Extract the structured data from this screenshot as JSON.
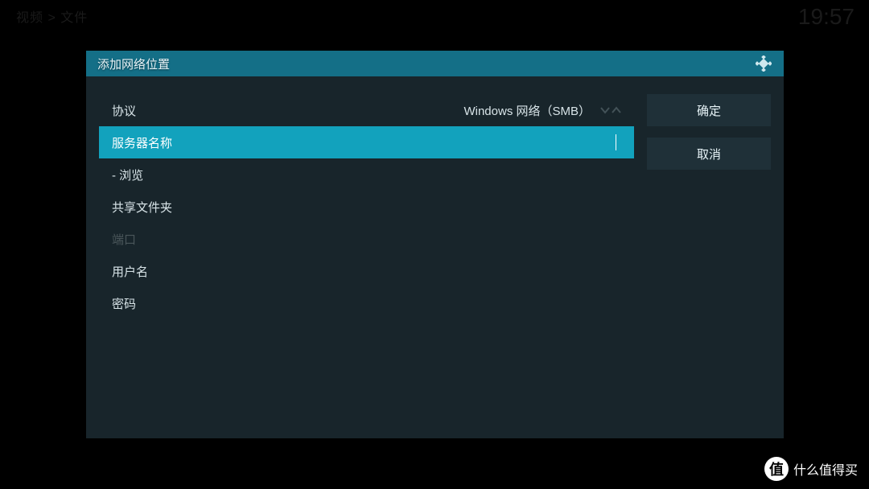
{
  "background": {
    "top_left_hint": "视频 > 文件",
    "clock": "19:57"
  },
  "dialog": {
    "title": "添加网络位置",
    "icon": "kodi-logo-icon",
    "form": {
      "protocol": {
        "label": "协议",
        "value": "Windows 网络（SMB）"
      },
      "server_name": {
        "label": "服务器名称",
        "value": ""
      },
      "browse": {
        "label": "- 浏览"
      },
      "shared_folder": {
        "label": "共享文件夹"
      },
      "port": {
        "label": "端口"
      },
      "username": {
        "label": "用户名"
      },
      "password": {
        "label": "密码"
      }
    },
    "actions": {
      "ok": "确定",
      "cancel": "取消"
    }
  },
  "watermark": {
    "badge": "值",
    "text": "什么值得买"
  }
}
